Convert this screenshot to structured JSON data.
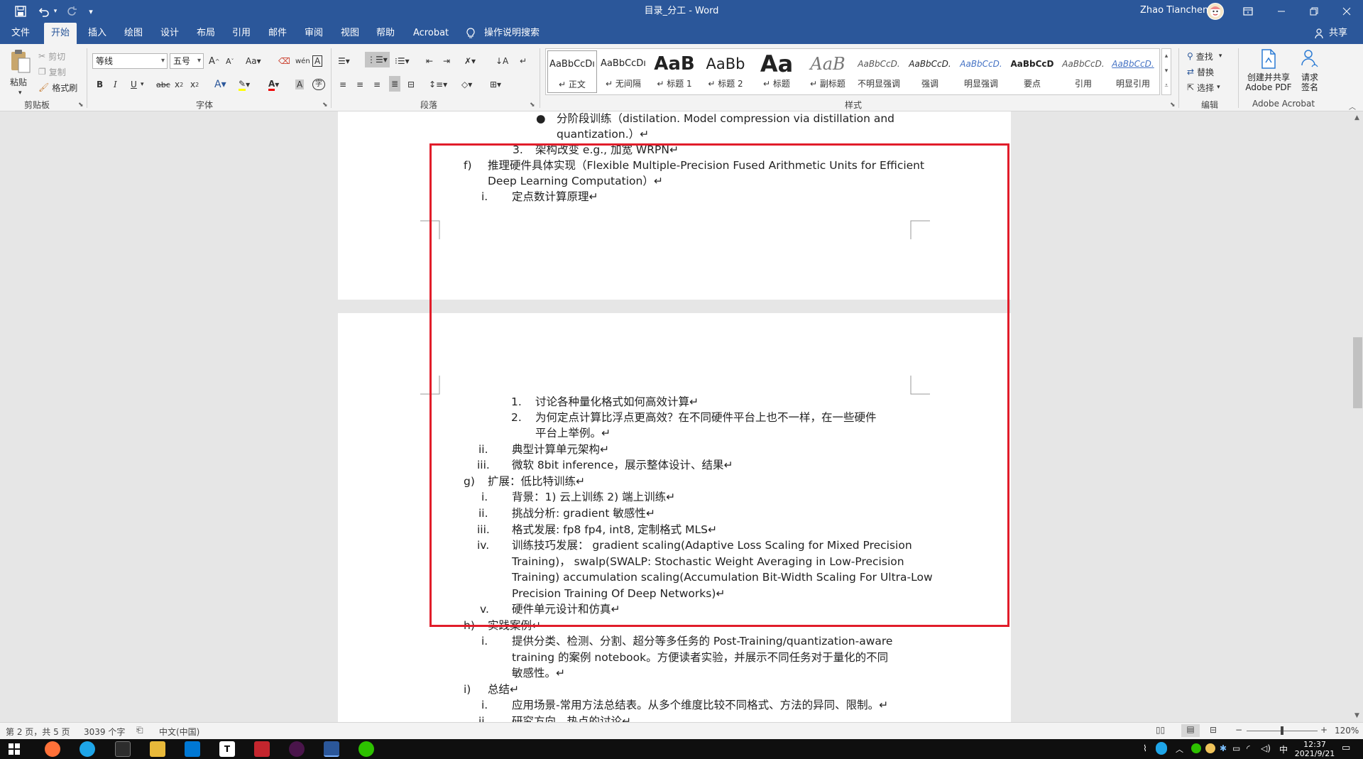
{
  "window": {
    "title": "目录_分工  -  Word",
    "user": "Zhao Tianchen"
  },
  "quick_access": {
    "save_icon": "save-icon",
    "undo_icon": "undo-icon",
    "redo_icon": "redo-icon",
    "customize_icon": "customize-icon"
  },
  "tabs": [
    {
      "label": "文件"
    },
    {
      "label": "开始"
    },
    {
      "label": "插入"
    },
    {
      "label": "绘图"
    },
    {
      "label": "设计"
    },
    {
      "label": "布局"
    },
    {
      "label": "引用"
    },
    {
      "label": "邮件"
    },
    {
      "label": "审阅"
    },
    {
      "label": "视图"
    },
    {
      "label": "帮助"
    },
    {
      "label": "Acrobat"
    }
  ],
  "tell_me": "操作说明搜索",
  "share": "共享",
  "ribbon": {
    "clipboard": {
      "label": "剪贴板",
      "paste": "粘贴",
      "cut": "剪切",
      "copy": "复制",
      "format_painter": "格式刷"
    },
    "font": {
      "label": "字体",
      "family": "等线",
      "size": "五号"
    },
    "paragraph": {
      "label": "段落"
    },
    "styles": {
      "label": "样式",
      "items": [
        {
          "preview": "AaBbCcDı",
          "name": "正文"
        },
        {
          "preview": "AaBbCcDı",
          "name": "无间隔"
        },
        {
          "preview": "AaB",
          "name": "标题 1"
        },
        {
          "preview": "AaBb",
          "name": "标题 2"
        },
        {
          "preview": "Aa",
          "name": "标题"
        },
        {
          "preview": "AaB",
          "name": "副标题"
        },
        {
          "preview": "AaBbCcD.",
          "name": "不明显强调"
        },
        {
          "preview": "AaBbCcD.",
          "name": "强调"
        },
        {
          "preview": "AaBbCcD.",
          "name": "明显强调"
        },
        {
          "preview": "AaBbCcD",
          "name": "要点"
        },
        {
          "preview": "AaBbCcD.",
          "name": "引用"
        },
        {
          "preview": "AaBbCcD.",
          "name": "明显引用"
        }
      ]
    },
    "editing": {
      "label": "编辑",
      "find": "查找",
      "replace": "替换",
      "select": "选择"
    },
    "acrobat": {
      "label": "Adobe Acrobat",
      "create_share_1": "创建并共享",
      "create_share_2": "Adobe PDF",
      "request_sign_1": "请求",
      "request_sign_2": "签名"
    }
  },
  "document": {
    "page1": [
      {
        "marker": "●",
        "text": "分阶段训练（distilation. Model compression via distillation and"
      },
      {
        "marker": "",
        "text": "quantization.）↵"
      },
      {
        "marker": "3.",
        "text": "架构改变 e.g., 加宽 WRPN↵"
      },
      {
        "marker": "f)",
        "text": "推理硬件具体实现（Flexible Multiple-Precision Fused Arithmetic Units for Efficient"
      },
      {
        "marker": "",
        "text": "Deep Learning Computation）↵"
      },
      {
        "marker": "i.",
        "text": "定点数计算原理↵"
      }
    ],
    "page2": [
      {
        "marker": "1.",
        "text": "讨论各种量化格式如何高效计算↵"
      },
      {
        "marker": "2.",
        "text": "为何定点计算比浮点更高效？在不同硬件平台上也不一样，在一些硬件"
      },
      {
        "marker": "",
        "text": "平台上举例。↵"
      },
      {
        "marker": "ii.",
        "text": "典型计算单元架构↵"
      },
      {
        "marker": "iii.",
        "text": "微软 8bit inference，展示整体设计、结果↵"
      },
      {
        "marker": "g)",
        "text": "扩展：低比特训练↵"
      },
      {
        "marker": "i.",
        "text": "背景：1) 云上训练  2) 端上训练↵"
      },
      {
        "marker": "ii.",
        "text": "挑战分析: gradient 敏感性↵"
      },
      {
        "marker": "iii.",
        "text": "格式发展: fp8 fp4, int8, 定制格式 MLS↵"
      },
      {
        "marker": "iv.",
        "text": "训练技巧发展： gradient scaling(Adaptive Loss Scaling for Mixed Precision"
      },
      {
        "marker": "",
        "text": "Training)，  swalp(SWALP: Stochastic Weight Averaging in Low-Precision"
      },
      {
        "marker": "",
        "text": "Training) accumulation scaling(Accumulation Bit-Width Scaling For Ultra-Low"
      },
      {
        "marker": "",
        "text": "Precision Training Of Deep Networks)↵"
      },
      {
        "marker": "v.",
        "text": "硬件单元设计和仿真↵"
      },
      {
        "marker": "h)",
        "text": "实践案例↵"
      },
      {
        "marker": "i.",
        "text": "提供分类、检测、分割、超分等多任务的 Post-Training/quantization-aware"
      },
      {
        "marker": "",
        "text": "training 的案例 notebook。方便读者实验，并展示不同任务对于量化的不同"
      },
      {
        "marker": "",
        "text": "敏感性。↵"
      },
      {
        "marker": "i)",
        "text": "总结↵"
      },
      {
        "marker": "i.",
        "text": "应用场景-常用方法总结表。从多个维度比较不同格式、方法的异同、限制。↵"
      },
      {
        "marker": "ii.",
        "text": "研究方向、热点的讨论↵"
      }
    ]
  },
  "status": {
    "page": "第 2 页，共 5 页",
    "words": "3039 个字",
    "language": "中文(中国)",
    "zoom": "120%"
  },
  "taskbar": {
    "time": "12:37",
    "date": "2021/9/21"
  },
  "colors": {
    "brand": "#2b579a",
    "highlight_box": "#e11d2a"
  }
}
